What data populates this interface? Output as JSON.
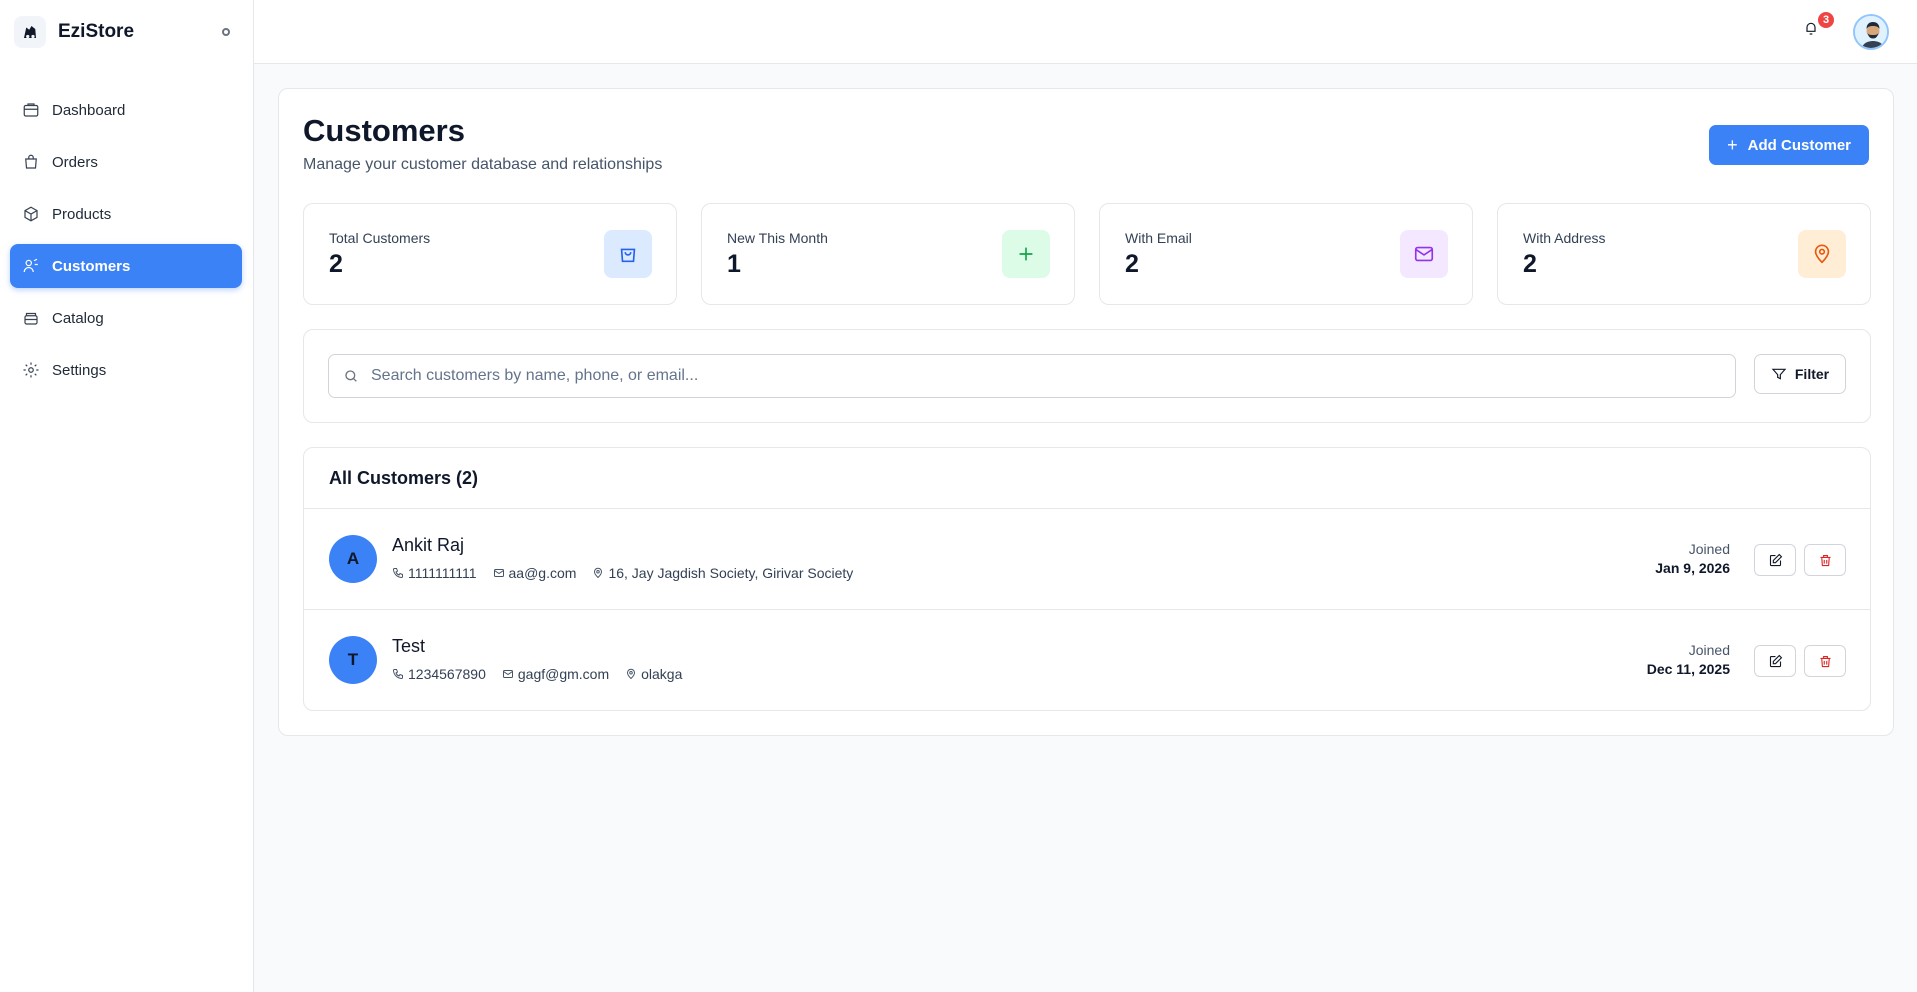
{
  "app": {
    "name": "EziStore"
  },
  "sidebar": {
    "items": [
      {
        "label": "Dashboard",
        "icon": "dashboard-icon",
        "active": false
      },
      {
        "label": "Orders",
        "icon": "shopping-bag-icon",
        "active": false
      },
      {
        "label": "Products",
        "icon": "package-icon",
        "active": false
      },
      {
        "label": "Customers",
        "icon": "users-icon",
        "active": true
      },
      {
        "label": "Catalog",
        "icon": "catalog-icon",
        "active": false
      },
      {
        "label": "Settings",
        "icon": "gear-icon",
        "active": false
      }
    ]
  },
  "topbar": {
    "notification_count": "3"
  },
  "page": {
    "title": "Customers",
    "subtitle": "Manage your customer database and relationships",
    "add_label": "Add Customer"
  },
  "stats": [
    {
      "label": "Total Customers",
      "value": "2",
      "icon": "shopping-bag-icon",
      "color": "#2563eb",
      "bg": "#dbeafe"
    },
    {
      "label": "New This Month",
      "value": "1",
      "icon": "plus-icon",
      "color": "#16a34a",
      "bg": "#dcfce7"
    },
    {
      "label": "With Email",
      "value": "2",
      "icon": "mail-icon",
      "color": "#9333ea",
      "bg": "#f3e8ff"
    },
    {
      "label": "With Address",
      "value": "2",
      "icon": "map-pin-icon",
      "color": "#ea580c",
      "bg": "#ffedd5"
    }
  ],
  "search": {
    "placeholder": "Search customers by name, phone, or email...",
    "value": "",
    "filter_label": "Filter"
  },
  "list": {
    "title": "All Customers (2)",
    "customers": [
      {
        "initial": "A",
        "name": "Ankit Raj",
        "phone": "1111111111",
        "email": "aa@g.com",
        "address": "16, Jay Jagdish Society, Girivar Society",
        "joined_label": "Joined",
        "joined_date": "Jan 9, 2026"
      },
      {
        "initial": "T",
        "name": "Test",
        "phone": "1234567890",
        "email": "gagf@gm.com",
        "address": "olakga",
        "joined_label": "Joined",
        "joined_date": "Dec 11, 2025"
      }
    ]
  },
  "colors": {
    "accent": "#3b82f6",
    "danger": "#ef4444"
  }
}
